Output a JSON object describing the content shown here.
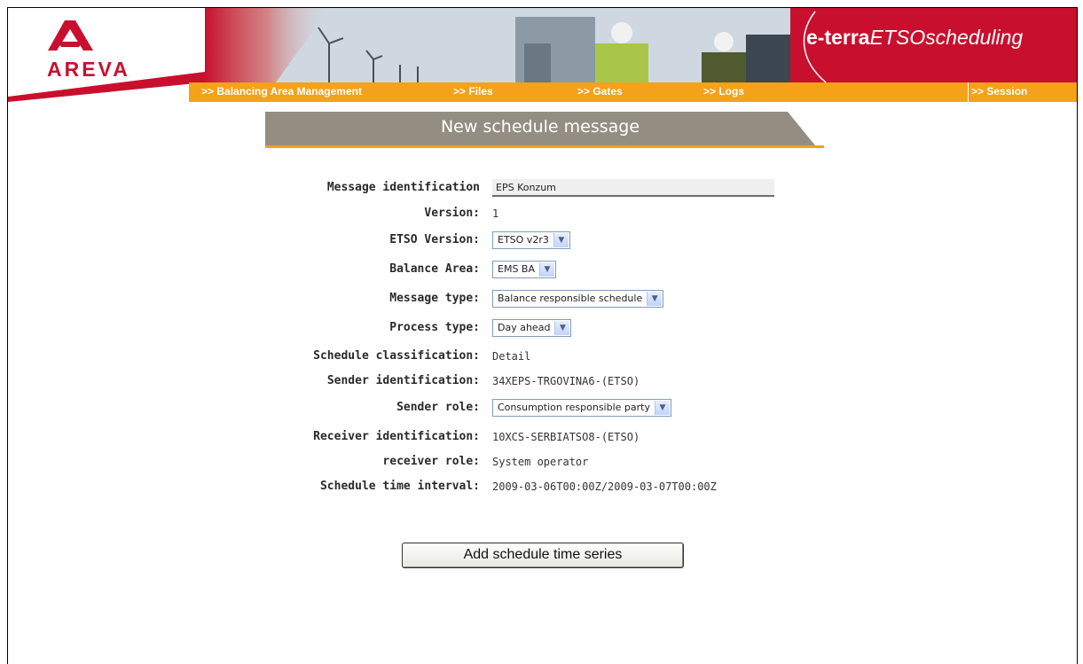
{
  "brand": {
    "company": "AREVA",
    "product_bold": "e-terra",
    "product_italic": "ETSOscheduling"
  },
  "nav": {
    "items": [
      {
        "label": ">> Balancing Area Management"
      },
      {
        "label": ">> Files"
      },
      {
        "label": ">> Gates"
      },
      {
        "label": ">> Logs"
      },
      {
        "label": ">> Session"
      }
    ]
  },
  "page": {
    "title": "New schedule message"
  },
  "form": {
    "message_identification": {
      "label": "Message identification",
      "value": "EPS Konzum"
    },
    "version": {
      "label": "Version:",
      "value": "1"
    },
    "etso_version": {
      "label": "ETSO Version:",
      "value": "ETSO v2r3"
    },
    "balance_area": {
      "label": "Balance Area:",
      "value": "EMS BA"
    },
    "message_type": {
      "label": "Message type:",
      "value": "Balance responsible schedule"
    },
    "process_type": {
      "label": "Process type:",
      "value": "Day ahead"
    },
    "schedule_classification": {
      "label": "Schedule classification:",
      "value": "Detail"
    },
    "sender_identification": {
      "label": "Sender identification:",
      "value": "34XEPS-TRGOVINA6-(ETSO)"
    },
    "sender_role": {
      "label": "Sender role:",
      "value": "Consumption responsible party"
    },
    "receiver_identification": {
      "label": "Receiver identification:",
      "value": "10XCS-SERBIATSO8-(ETSO)"
    },
    "receiver_role": {
      "label": "receiver role:",
      "value": "System operator"
    },
    "schedule_time_interval": {
      "label": "Schedule time interval:",
      "value": "2009-03-06T00:00Z/2009-03-07T00:00Z"
    }
  },
  "actions": {
    "add_series_label": "Add schedule time series"
  },
  "colors": {
    "brand_red": "#c8102e",
    "nav_orange": "#f5a11a",
    "title_gray": "#948e82"
  }
}
